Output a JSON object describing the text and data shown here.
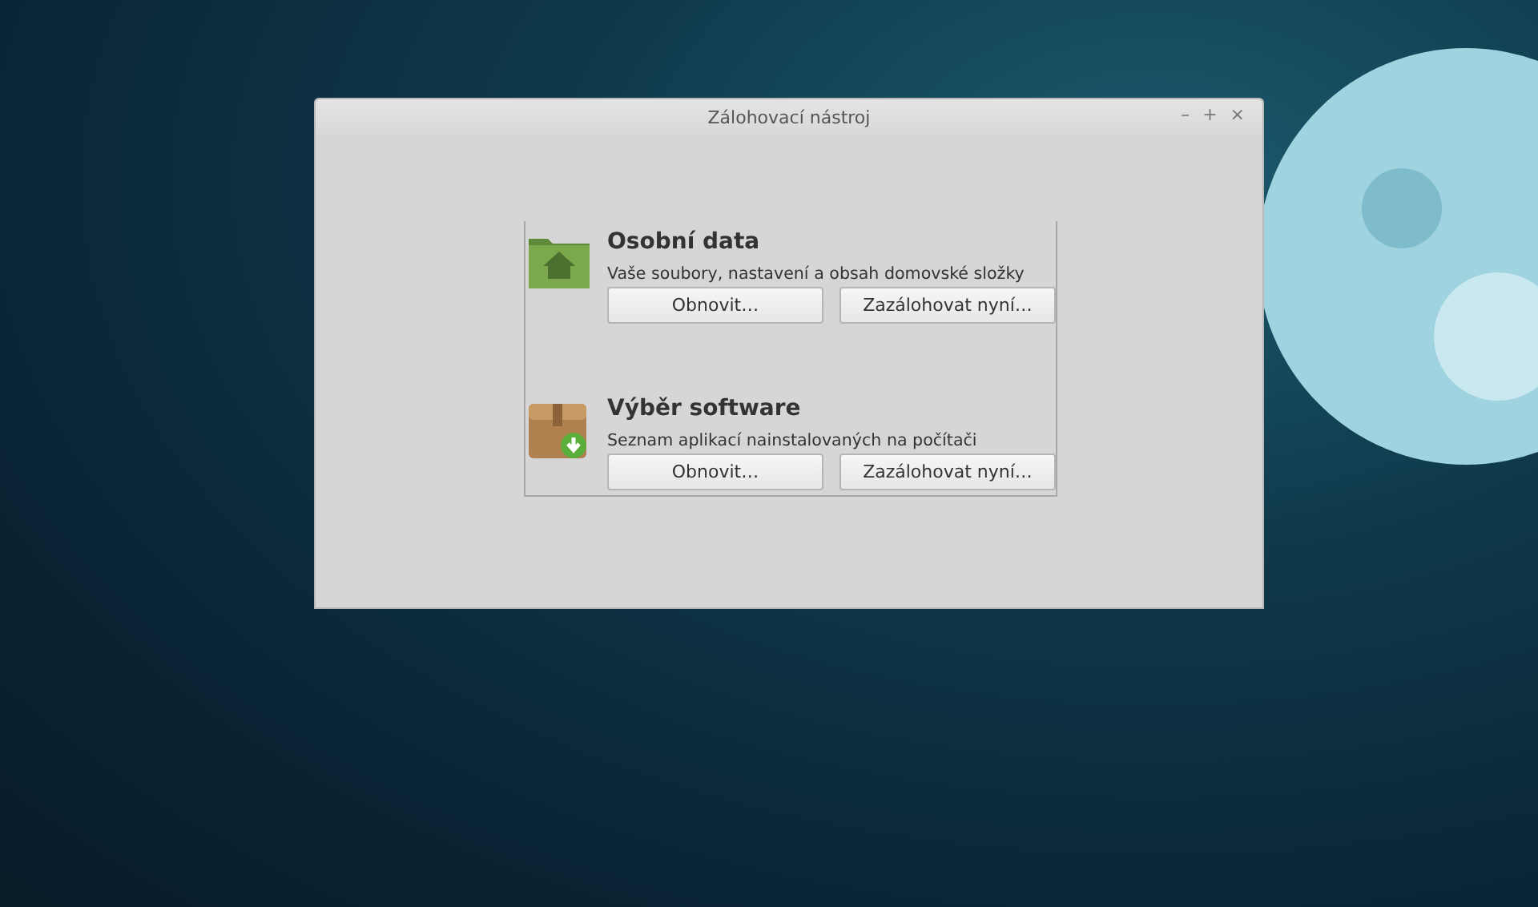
{
  "window": {
    "title": "Zálohovací nástroj",
    "controls": [
      "–",
      "+",
      "×"
    ]
  },
  "sections": [
    {
      "kind": "home",
      "title": "Osobní data",
      "description": "Vaše soubory, nastavení a obsah domovské složky",
      "buttons": [
        "Obnovit…",
        "Zazálohovat nyní…"
      ]
    },
    {
      "kind": "package",
      "title": "Výběr software",
      "description": "Seznam aplikací nainstalovaných na počítači",
      "buttons": [
        "Obnovit…",
        "Zazálohovat nyní…"
      ]
    }
  ]
}
